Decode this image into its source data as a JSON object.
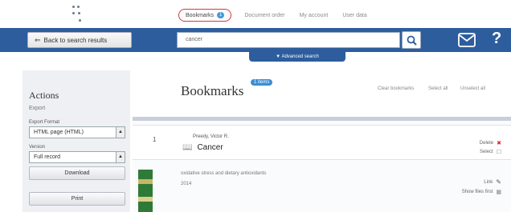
{
  "topnav": {
    "items": [
      {
        "label": "Bookmarks",
        "count": "1"
      },
      {
        "label": "Document order"
      },
      {
        "label": "My account"
      },
      {
        "label": "User data"
      }
    ]
  },
  "searchbar": {
    "back_label": "Back to search results",
    "query": "cancer",
    "advanced_label": "▼ Advanced search"
  },
  "sidebar": {
    "title": "Actions",
    "export_link": "Export",
    "format_label": "Export Format",
    "format_value": "HTML page (HTML)",
    "version_label": "Version",
    "version_value": "Full record",
    "download_label": "Download",
    "print_label": "Print"
  },
  "main": {
    "title": "Bookmarks",
    "badge": "1 items",
    "links": [
      "Clear bookmarks",
      "Select all",
      "Unselect all"
    ]
  },
  "records": [
    {
      "number": "1",
      "author": "Preedy, Victor R.",
      "title": "Cancer",
      "actions": [
        {
          "label": "Delete",
          "icon": "delete-icon"
        },
        {
          "label": "Select",
          "icon": "checkbox-icon"
        }
      ]
    },
    {
      "title": "oxidative stress and dietary antioxidants",
      "year": "2014",
      "actions": [
        {
          "label": "Link",
          "icon": "link-icon"
        },
        {
          "label": "Show files first",
          "icon": "grid-icon"
        }
      ]
    }
  ],
  "colors": {
    "brand_blue": "#2d5d9d",
    "highlight_circle": "#d23a3a",
    "badge_blue": "#3a8ed6"
  }
}
